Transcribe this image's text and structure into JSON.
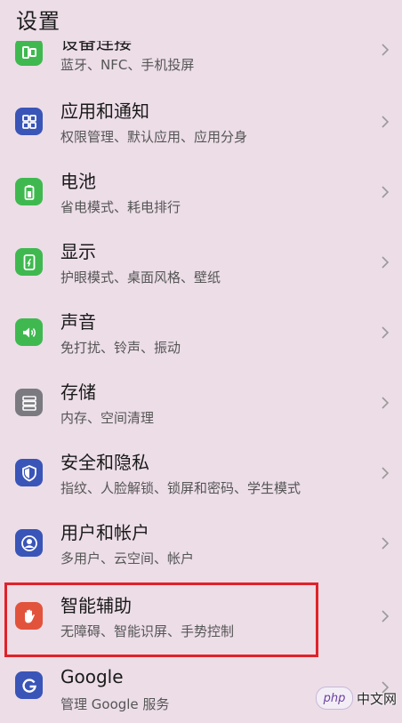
{
  "header": {
    "title": "设置"
  },
  "items": [
    {
      "title": "设备连接",
      "subtitle": "蓝牙、NFC、手机投屏",
      "icon": "device-connection-icon",
      "color": "#3fb94f"
    },
    {
      "title": "应用和通知",
      "subtitle": "权限管理、默认应用、应用分身",
      "icon": "apps-grid-icon",
      "color": "#3a55b8"
    },
    {
      "title": "电池",
      "subtitle": "省电模式、耗电排行",
      "icon": "battery-icon",
      "color": "#3fb94f"
    },
    {
      "title": "显示",
      "subtitle": "护眼模式、桌面风格、壁纸",
      "icon": "display-icon",
      "color": "#3fb94f"
    },
    {
      "title": "声音",
      "subtitle": "免打扰、铃声、振动",
      "icon": "speaker-icon",
      "color": "#3fb94f"
    },
    {
      "title": "存储",
      "subtitle": "内存、空间清理",
      "icon": "storage-icon",
      "color": "#7a7a80"
    },
    {
      "title": "安全和隐私",
      "subtitle": "指纹、人脸解锁、锁屏和密码、学生模式",
      "icon": "shield-icon",
      "color": "#3a55b8"
    },
    {
      "title": "用户和帐户",
      "subtitle": "多用户、云空间、帐户",
      "icon": "user-icon",
      "color": "#3a55b8"
    },
    {
      "title": "智能辅助",
      "subtitle": "无障碍、智能识屏、手势控制",
      "icon": "hand-icon",
      "color": "#e2533c"
    },
    {
      "title": "Google",
      "subtitle": "管理 Google 服务",
      "icon": "google-icon",
      "color": "#3a55b8"
    }
  ],
  "watermark": {
    "logo": "php",
    "text": "中文网"
  }
}
